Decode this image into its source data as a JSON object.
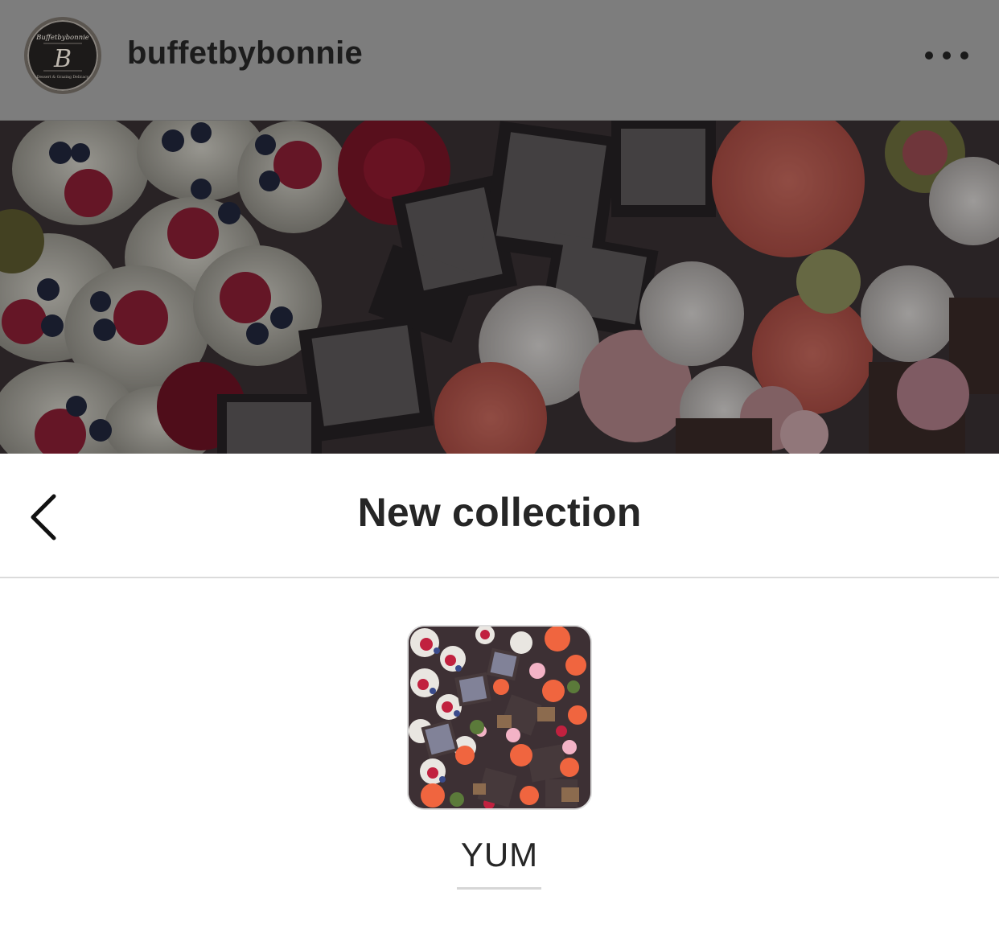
{
  "post": {
    "username": "buffetbybonnie",
    "avatar_logo": {
      "top_text": "Buffetbybonnie",
      "monogram": "B",
      "bottom_text": "Dessert & Grazing Delicacy"
    },
    "more_icon": "more-horizontal-icon",
    "image_description_icon": "dessert-platter-photo"
  },
  "sheet": {
    "back_icon": "chevron-left-icon",
    "title": "New collection",
    "collection_name_value": "YUM",
    "overlay_color": "#7d7d7d",
    "divider_color": "#dbdbdb"
  }
}
